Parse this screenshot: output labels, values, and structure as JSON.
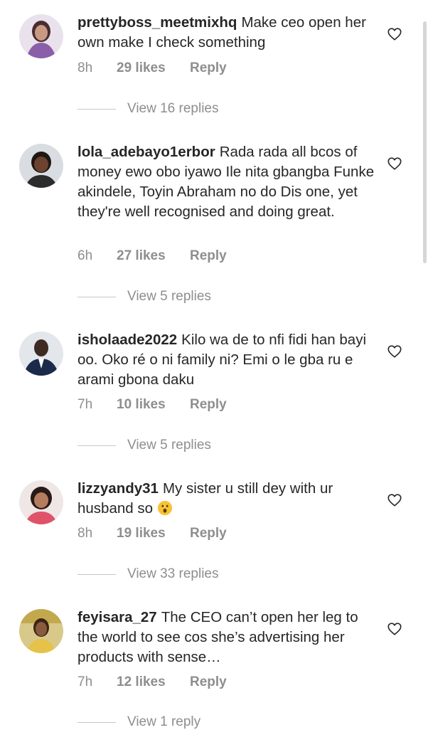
{
  "comments": [
    {
      "username": "prettyboss_meetmixhq",
      "text": "Make ceo open her own make I check something",
      "time": "8h",
      "likes": "29 likes",
      "reply": "Reply",
      "view_replies": "View 16 replies",
      "avatar_icon": "avatar-woman-purple"
    },
    {
      "username": "lola_adebayo1erbor",
      "text": "Rada rada all bcos of money ewo obo iyawo Ile nita gbangba Funke akindele, Toyin Abraham no do Dis one, yet they're well recognised and doing great.",
      "time": "6h",
      "likes": "27 likes",
      "reply": "Reply",
      "view_replies": "View 5 replies",
      "avatar_icon": "avatar-woman-dark"
    },
    {
      "username": "isholaade2022",
      "text": "Kilo wa de to nfi fidi han bayi oo. Oko ré o ni family ni? Emi o le gba ru e arami gbona daku",
      "time": "7h",
      "likes": "10 likes",
      "reply": "Reply",
      "view_replies": "View 5 replies",
      "avatar_icon": "avatar-man-suit"
    },
    {
      "username": "lizzyandy31",
      "text": "My sister u still dey with ur husband so",
      "emoji": "astonished-face",
      "time": "8h",
      "likes": "19 likes",
      "reply": "Reply",
      "view_replies": "View 33 replies",
      "avatar_icon": "avatar-woman-smiling"
    },
    {
      "username": "feyisara_27",
      "text": "The CEO can’t open her leg to the world to see cos she’s advertising her products with sense…",
      "time": "7h",
      "likes": "12 likes",
      "reply": "Reply",
      "view_replies": "View 1 reply",
      "avatar_icon": "avatar-woman-yellow"
    }
  ],
  "colors": {
    "text": "#262626",
    "muted": "#8e8e8e",
    "divider": "#c7c7c7"
  }
}
